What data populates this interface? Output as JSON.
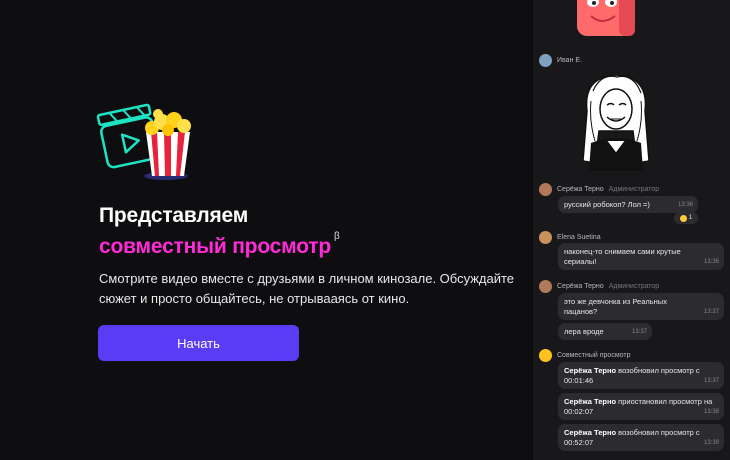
{
  "main": {
    "headline_line1": "Представляем",
    "headline_line2": "совместный просмотр",
    "beta_mark": "β",
    "description": "Смотрите видео вместе с друзьями в личном кинозале. Обсуждайте сюжет и просто общайтесь, не отрывааясь от кино.",
    "start_button": "Начать"
  },
  "chat": {
    "messages": [
      {
        "author": "Иван Е.",
        "role": "",
        "type": "sticker"
      },
      {
        "author": "Серёжа Терно",
        "role": "Администратор",
        "text": "русский робокоп? Лол =)",
        "time": "13:36",
        "reaction_count": "1"
      },
      {
        "author": "Elena Suetina",
        "role": "",
        "text": "наконец-то снимаем сами крутые сериалы!",
        "time": "13:36"
      },
      {
        "author": "Серёжа Терно",
        "role": "Администратор",
        "text": "это же девчонка из Реальных пацанов?",
        "time": "13:37"
      },
      {
        "author": "",
        "role": "",
        "text": "лера вроде",
        "time": "13:37"
      },
      {
        "author": "Совместный просмотр",
        "role": ""
      },
      {
        "name": "Серёжа Терно",
        "text": "возобновил просмотр с 00:01:46",
        "time": "13:37"
      },
      {
        "name": "Серёжа Терно",
        "text": "приостановил просмотр на 00:02:07",
        "time": "13:38"
      },
      {
        "name": "Серёжа Терно",
        "text": "возобновил просмотр с 00:52:07",
        "time": "13:39"
      }
    ]
  },
  "colors": {
    "accent_pink": "#ff2bd6",
    "button_purple": "#5b3cf5",
    "background": "#0e0e10",
    "chat_background": "#18181a"
  }
}
